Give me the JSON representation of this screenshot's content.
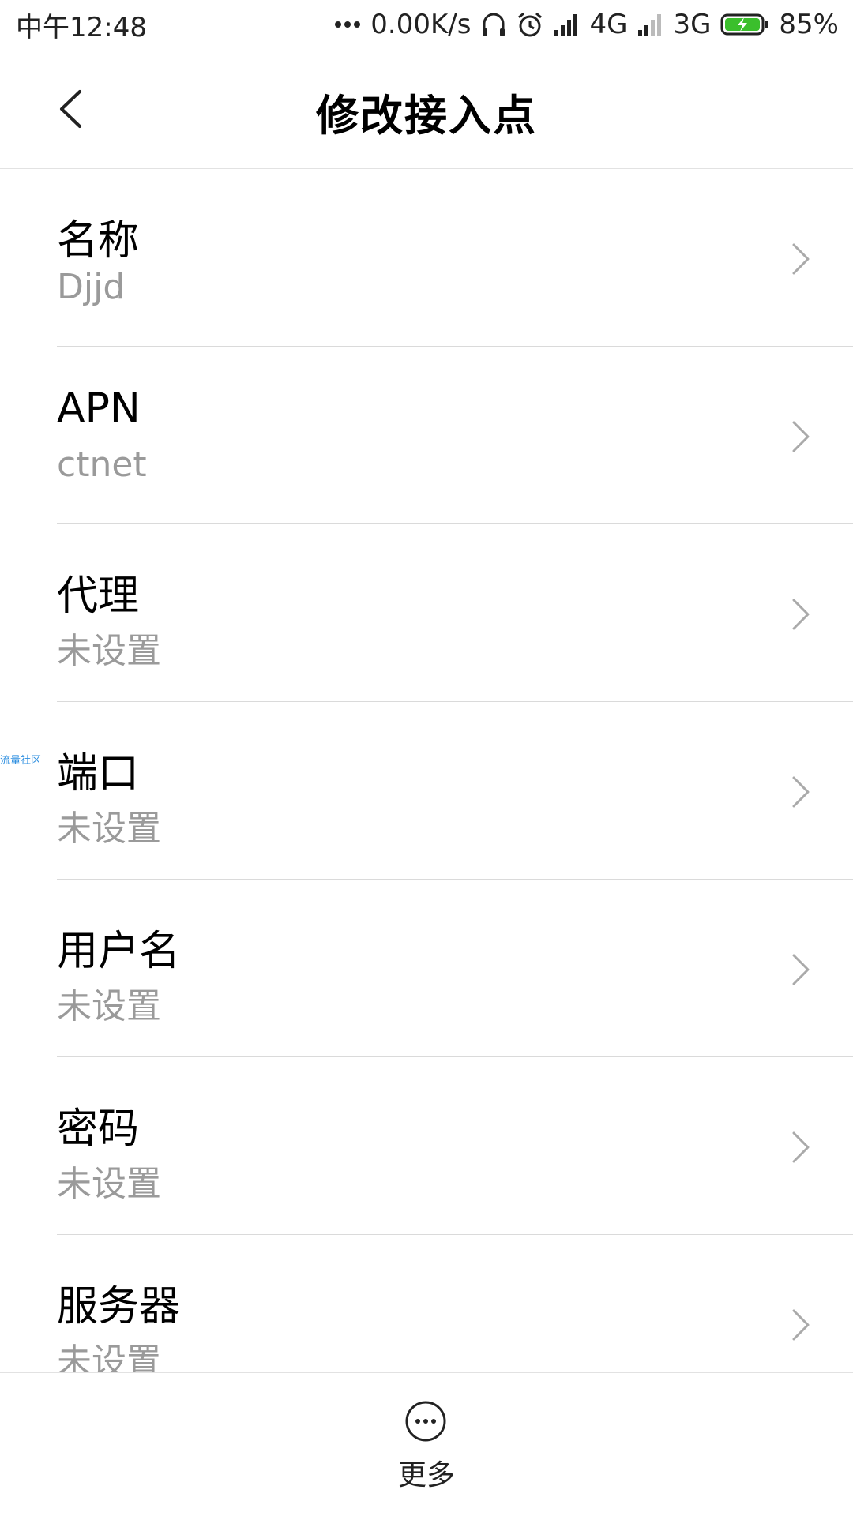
{
  "status_bar": {
    "time": "中午12:48",
    "net_speed": "0.00K/s",
    "network_1": "4G",
    "network_2": "3G",
    "battery": "85%",
    "accent_battery": "#3bbf2c"
  },
  "header": {
    "title": "修改接入点"
  },
  "items": [
    {
      "title": "名称",
      "value": "Djjd"
    },
    {
      "title": "APN",
      "value": "ctnet"
    },
    {
      "title": "代理",
      "value": "未设置"
    },
    {
      "title": "端口",
      "value": "未设置"
    },
    {
      "title": "用户名",
      "value": "未设置"
    },
    {
      "title": "密码",
      "value": "未设置"
    },
    {
      "title": "服务器",
      "value": "未设置"
    }
  ],
  "watermark": "流量社区",
  "bottom_bar": {
    "more_label": "更多"
  }
}
